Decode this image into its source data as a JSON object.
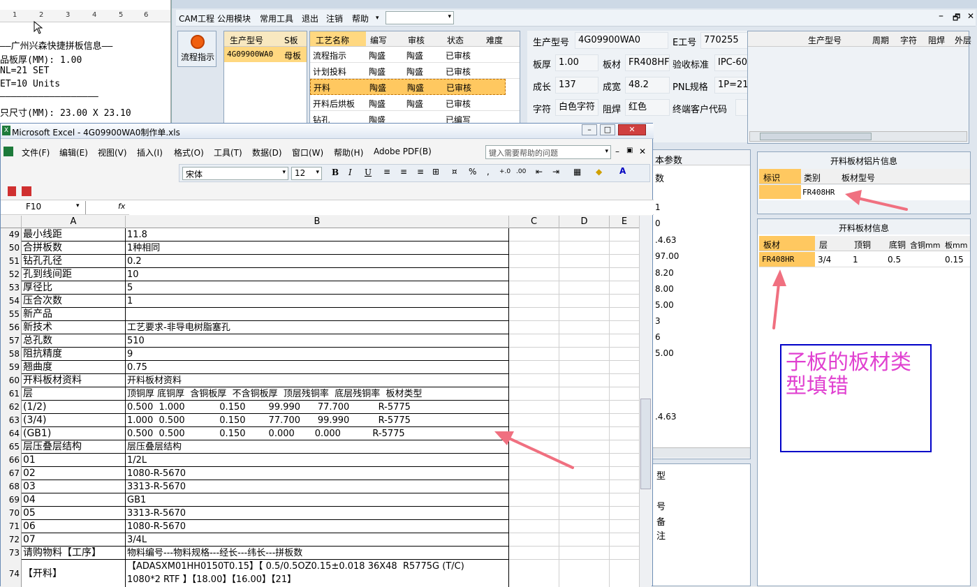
{
  "doc": {
    "ruler_marks": [
      "1",
      "2",
      "3",
      "4",
      "5",
      "6"
    ],
    "lines": [
      "——广州兴森快捷拼板信息——",
      "品板厚(MM): 1.00",
      "NL=21 SET",
      "ET=10 Units",
      "——————————————————",
      "只尺寸(MM): 23.00 X 23.10"
    ]
  },
  "cam": {
    "menu": [
      "CAM工程",
      "公用模块",
      "常用工具",
      "退出",
      "注销",
      "帮助"
    ],
    "flow_button": "流程指示",
    "left_grid": {
      "headers": [
        "生产型号",
        "S板"
      ],
      "row": [
        "4G09900WA0",
        "母板"
      ]
    },
    "process_grid": {
      "headers": [
        "工艺名称",
        "编写",
        "审核",
        "状态",
        "难度"
      ],
      "rows": [
        [
          "流程指示",
          "陶盛",
          "陶盛",
          "已审核",
          ""
        ],
        [
          "计划投料",
          "陶盛",
          "陶盛",
          "已审核",
          ""
        ],
        [
          "开料",
          "陶盛",
          "陶盛",
          "已审核",
          ""
        ],
        [
          "开料后烘板",
          "陶盛",
          "陶盛",
          "已审核",
          ""
        ],
        [
          "钻孔",
          "陶盛",
          "",
          "已编写",
          ""
        ]
      ]
    },
    "info": {
      "prod_label": "生产型号",
      "prod_value": "4G09900WA0",
      "e_label": "E工号",
      "e_value": "770255",
      "thick_label": "板厚",
      "thick_value": "1.00",
      "mat_label": "板材",
      "mat_value": "FR408HF",
      "accept_label": "验收标准",
      "accept_value": "IPC-60",
      "len_label": "成长",
      "len_value": "137",
      "wid_label": "成宽",
      "wid_value": "48.2",
      "pnl_label": "PNL规格",
      "pnl_value": "1P=21",
      "char_label": "字符",
      "char_value": "白色字符",
      "mask_label": "阻焊",
      "mask_value": "红色",
      "client_label": "终端客户代码",
      "client_value": ""
    },
    "right_grid_headers": [
      "生产型号",
      "周期",
      "字符",
      "阻焊",
      "外层"
    ],
    "params_title": "本参数",
    "params_sub": "数",
    "params_values": [
      "1",
      "0",
      ".4.63",
      "97.00",
      "8.20",
      "8.00",
      "5.00",
      "3",
      "6",
      "5.00",
      "",
      ".4.63"
    ],
    "lower_left_chars": [
      "型",
      "号",
      "备",
      "注"
    ],
    "cut_panel": {
      "title": "开料板材铝片信息",
      "headers": [
        "标识",
        "类别",
        "板材型号"
      ],
      "row": [
        "",
        "FR408HR",
        ""
      ]
    },
    "mat_panel": {
      "title": "开料板材信息",
      "headers": [
        "板材",
        "层",
        "顶铜",
        "底铜",
        "含铜mm",
        "板mm"
      ],
      "row": [
        "FR408HR",
        "3/4",
        "1",
        "0.5",
        "",
        "0.15"
      ]
    },
    "note": "子板的板材类型填错"
  },
  "excel": {
    "title": "Microsoft Excel - 4G09900WA0制作单.xls",
    "menu": [
      "文件(F)",
      "编辑(E)",
      "视图(V)",
      "插入(I)",
      "格式(O)",
      "工具(T)",
      "数据(D)",
      "窗口(W)",
      "帮助(H)",
      "Adobe PDF(B)"
    ],
    "help_placeholder": "键入需要帮助的问题",
    "font_name": "宋体",
    "font_size": "12",
    "name_box": "F10",
    "fx": "fx",
    "columns": [
      "A",
      "B",
      "C",
      "D",
      "E"
    ],
    "rows": [
      {
        "n": "49",
        "a": "最小线距",
        "b": "11.8"
      },
      {
        "n": "50",
        "a": "合拼板数",
        "b": "1种相同"
      },
      {
        "n": "51",
        "a": "钻孔孔径",
        "b": "0.2"
      },
      {
        "n": "52",
        "a": "孔到线间距",
        "b": "10"
      },
      {
        "n": "53",
        "a": "厚径比",
        "b": "5"
      },
      {
        "n": "54",
        "a": "压合次数",
        "b": "1"
      },
      {
        "n": "55",
        "a": "新产品",
        "b": ""
      },
      {
        "n": "56",
        "a": "新技术",
        "b": "工艺要求-非导电树脂塞孔"
      },
      {
        "n": "57",
        "a": "总孔数",
        "b": "510"
      },
      {
        "n": "58",
        "a": "阻抗精度",
        "b": "9"
      },
      {
        "n": "59",
        "a": "翘曲度",
        "b": "0.75"
      },
      {
        "n": "60",
        "a": "开料板材资料",
        "b": "开料板材资料"
      },
      {
        "n": "61",
        "a": "层",
        "b": "顶铜厚 底铜厚  含铜板厚  不含铜板厚  顶层残铜率  底层残铜率  板材类型"
      },
      {
        "n": "62",
        "a": "(1/2)",
        "b": "0.500  1.000            0.150        99.990      77.700          R-5775"
      },
      {
        "n": "63",
        "a": "(3/4)",
        "b": "1.000  0.500            0.150        77.700      99.990          R-5775"
      },
      {
        "n": "64",
        "a": "(GB1)",
        "b": "0.500  0.500            0.150        0.000       0.000           R-5775"
      },
      {
        "n": "65",
        "a": "层压叠层结构",
        "b": "层压叠层结构"
      },
      {
        "n": "66",
        "a": "01",
        "b": "1/2L"
      },
      {
        "n": "67",
        "a": "02",
        "b": "1080-R-5670"
      },
      {
        "n": "68",
        "a": "03",
        "b": "3313-R-5670"
      },
      {
        "n": "69",
        "a": "04",
        "b": "GB1"
      },
      {
        "n": "70",
        "a": "05",
        "b": "3313-R-5670"
      },
      {
        "n": "71",
        "a": "06",
        "b": "1080-R-5670"
      },
      {
        "n": "72",
        "a": "07",
        "b": "3/4L"
      },
      {
        "n": "73",
        "a": "请购物料【工序】",
        "b": "物料编号---物料规格---经长---纬长---拼板数"
      }
    ],
    "row74": {
      "n": "74",
      "a": "【开料】",
      "b1": "【ADASXM01HH0150T0.15】【 0.5/0.5OZ0.15±0.018 36X48  R5775G (T/C)",
      "b2": "1080*2 RTF 】【18.00】【16.00】【21】"
    }
  },
  "colors": {
    "accent": "#ffcc66",
    "note_border": "#0000c8",
    "note_text": "#e040d0",
    "arrow": "#f07080"
  }
}
